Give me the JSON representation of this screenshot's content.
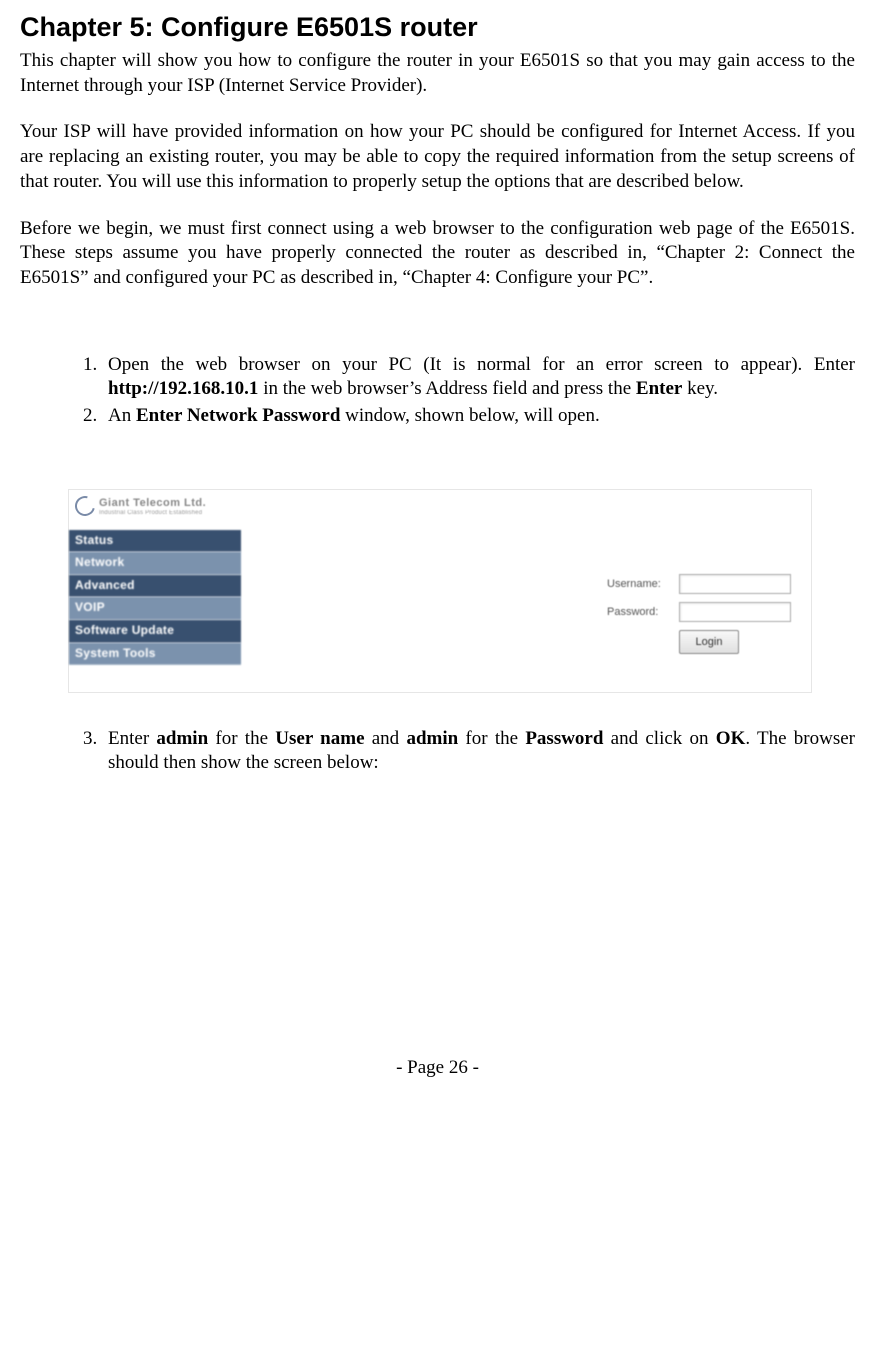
{
  "chapter_title": "Chapter 5: Configure E6501S router",
  "para1": "This chapter will show you how to configure the router in your E6501S so that you may gain access to the Internet through your ISP (Internet Service Provider).",
  "para2": "Your ISP will have provided information on how your PC should be configured for Internet Access.  If you are replacing an existing router, you may be able to copy the required information from the setup screens of that router.  You will use this information to properly setup the options that are described below.",
  "para3": "Before we begin, we must first connect using a web browser to the configuration web page of the E6501S. These steps assume you have properly connected the router as described in, “Chapter 2: Connect the E6501S” and configured your PC as described in, “Chapter 4: Configure your PC”.",
  "step1": {
    "pre": "Open the web browser on your PC (It is normal for an error screen to appear). Enter ",
    "bold1": "http://192.168.10.1",
    "mid": " in the web browser’s Address field and press the ",
    "bold2": "Enter",
    "post": " key."
  },
  "step2": {
    "pre": "An ",
    "bold1": "Enter Network Password",
    "post": " window, shown below, will open."
  },
  "step3": {
    "t1": "Enter ",
    "b1": "admin",
    "t2": " for the ",
    "b2": "User name",
    "t3": " and ",
    "b3": "admin",
    "t4": " for the ",
    "b4": "Password",
    "t5": " and click on ",
    "b5": "OK",
    "t6": ". The browser should then show the screen below:"
  },
  "figure": {
    "logo_text": "Giant Telecom Ltd.",
    "logo_sub": "Industrial Class Product Established",
    "nav": [
      "Status",
      "Network",
      "Advanced",
      "VOIP",
      "Software Update",
      "System Tools"
    ],
    "username_label": "Username:",
    "password_label": "Password:",
    "login_button": "Login"
  },
  "page_number": "- Page 26 -"
}
